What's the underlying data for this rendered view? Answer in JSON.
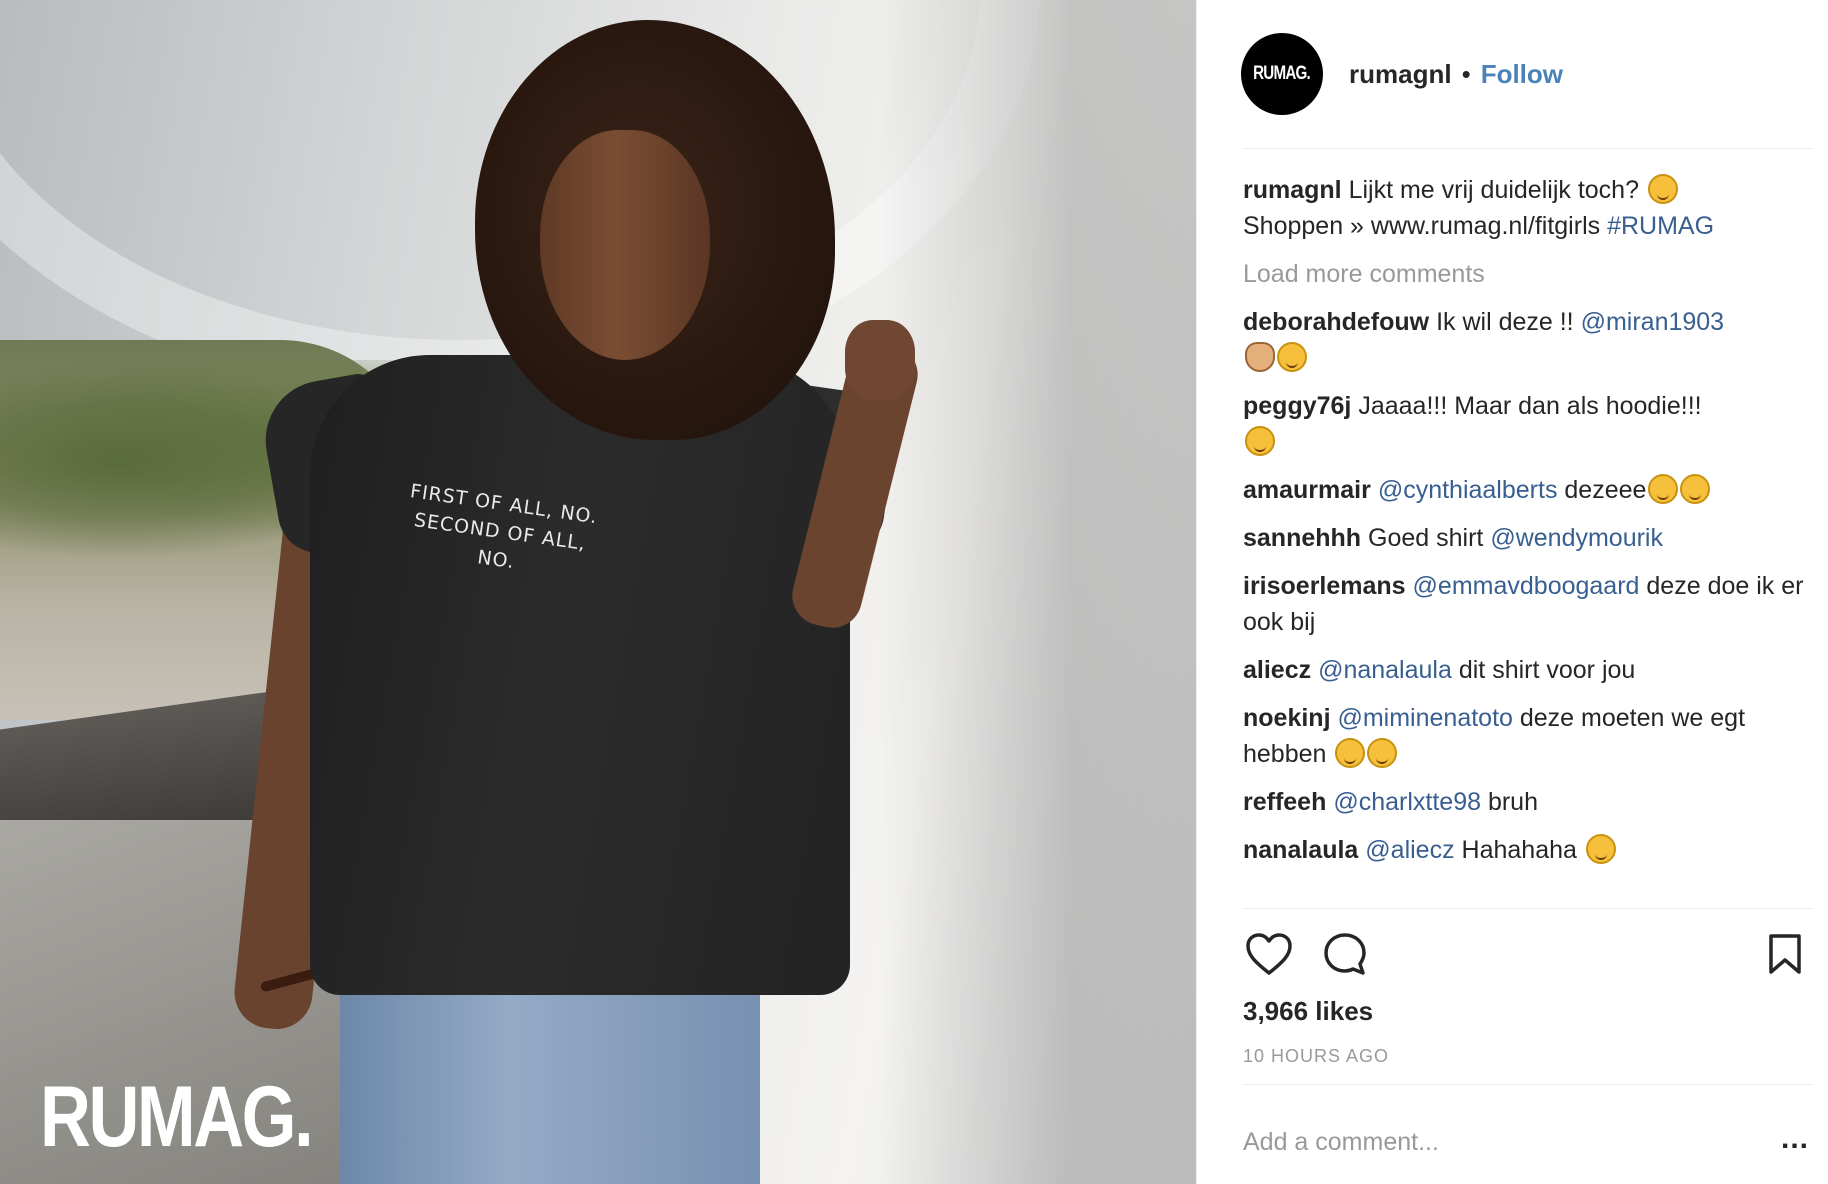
{
  "photo": {
    "shirt_line1": "FIRST OF ALL, NO.",
    "shirt_line2": "SECOND OF ALL, NO.",
    "watermark": "RUMAG."
  },
  "header": {
    "avatar_text": "RUMAG.",
    "username": "rumagnl",
    "separator": "•",
    "follow_label": "Follow"
  },
  "caption": {
    "user": "rumagnl",
    "text": "Lijkt me vrij duidelijk toch?",
    "line2": "Shoppen » www.rumag.nl/fitgirls",
    "hashtag": "#RUMAG"
  },
  "load_more": "Load more comments",
  "comments": [
    {
      "user": "deborahdefouw",
      "text": "Ik wil deze !!",
      "mention": "@miran1903",
      "after": ""
    },
    {
      "user": "peggy76j",
      "text": "Jaaaa!!! Maar dan als hoodie!!!",
      "mention": "",
      "after": ""
    },
    {
      "user": "amaurmair",
      "text": "",
      "mention": "@cynthiaalberts",
      "after": "dezeee"
    },
    {
      "user": "sannehhh",
      "text": "Goed shirt",
      "mention": "@wendymourik",
      "after": ""
    },
    {
      "user": "irisoerlemans",
      "text": "",
      "mention": "@emmavdboogaard",
      "after": "deze doe ik er ook bij"
    },
    {
      "user": "aliecz",
      "text": "",
      "mention": "@nanalaula",
      "after": "dit shirt voor jou"
    },
    {
      "user": "noekinj",
      "text": "",
      "mention": "@miminenatoto",
      "after": "deze moeten we egt hebben"
    },
    {
      "user": "reffeeh",
      "text": "",
      "mention": "@charlxtte98",
      "after": "bruh"
    },
    {
      "user": "nanalaula",
      "text": "",
      "mention": "@aliecz",
      "after": "Hahahaha"
    }
  ],
  "icons": {
    "like": "heart-icon",
    "comment": "comment-bubble-icon",
    "save": "bookmark-icon",
    "more": "ellipsis-icon"
  },
  "likes": "3,966 likes",
  "time_ago": "10 HOURS AGO",
  "add_comment_placeholder": "Add a comment...",
  "more_label": "...",
  "colors": {
    "link": "#385f90",
    "follow": "#4a82b8",
    "muted": "#999999",
    "text": "#262626"
  }
}
